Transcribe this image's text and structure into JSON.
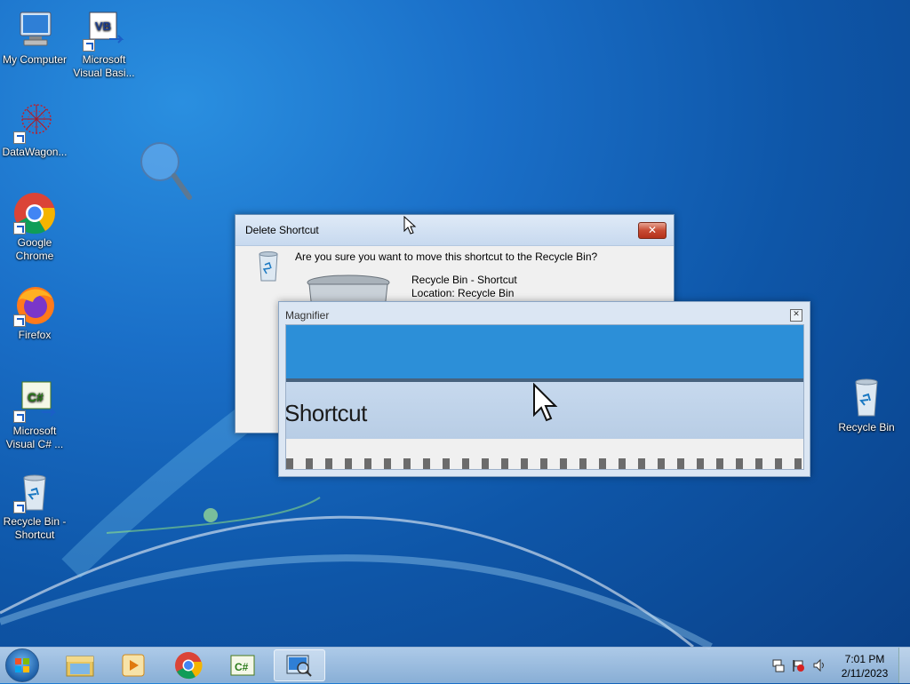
{
  "desktop": {
    "icons": [
      {
        "label": "My Computer"
      },
      {
        "label": "Microsoft Visual Basi..."
      },
      {
        "label": "DataWagon..."
      },
      {
        "label": "Google Chrome"
      },
      {
        "label": "Firefox"
      },
      {
        "label": "Microsoft Visual C# ..."
      },
      {
        "label": "Recycle Bin - Shortcut"
      },
      {
        "label": "Recycle Bin"
      }
    ]
  },
  "delete_dialog": {
    "title": "Delete Shortcut",
    "close_glyph": "✕",
    "question": "Are you sure you want to move this shortcut to the Recycle Bin?",
    "item_name": "Recycle Bin - Shortcut",
    "item_location": "Location: Recycle Bin"
  },
  "magnifier": {
    "title": "Magnifier",
    "close_glyph": "✕",
    "zoomed_text": "Shortcut"
  },
  "taskbar": {
    "items": [
      {
        "icon": "windows-explorer-icon"
      },
      {
        "icon": "media-player-icon"
      },
      {
        "icon": "chrome-icon"
      },
      {
        "icon": "visual-csharp-icon"
      },
      {
        "icon": "magnifier-icon"
      }
    ],
    "clock_time": "7:01 PM",
    "clock_date": "2/11/2023"
  }
}
